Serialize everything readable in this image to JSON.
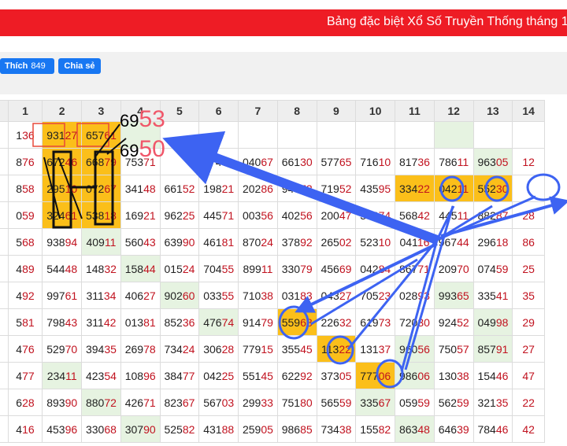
{
  "banner": {
    "title": "Bảng đặc biệt Xổ Số Truyền Thống tháng 11"
  },
  "social": {
    "like_label": "Thích",
    "like_count": "849",
    "share_label": "Chia sẻ"
  },
  "columns": [
    "0",
    "1",
    "2",
    "3",
    "4",
    "5",
    "6",
    "7",
    "8",
    "9",
    "10",
    "11",
    "12",
    "13",
    "14"
  ],
  "rows": [
    [
      "",
      "136",
      "93127",
      "65761",
      "",
      "",
      "",
      "",
      "",
      "",
      "",
      "",
      "",
      "",
      ""
    ],
    [
      "",
      "876",
      "67246",
      "66879",
      "75371",
      "",
      "77471",
      "04067",
      "66130",
      "57765",
      "71610",
      "81736",
      "78611",
      "96305",
      "12"
    ],
    [
      "",
      "858",
      "29510",
      "07267",
      "34148",
      "66152",
      "19821",
      "20286",
      "94772",
      "71952",
      "43595",
      "33422",
      "04211",
      "55230",
      ""
    ],
    [
      "",
      "059",
      "32461",
      "53818",
      "16921",
      "96225",
      "44571",
      "00356",
      "40256",
      "20047",
      "37874",
      "56842",
      "44511",
      "88287",
      "28"
    ],
    [
      "",
      "568",
      "93894",
      "40911",
      "56043",
      "63990",
      "46181",
      "87024",
      "37892",
      "26502",
      "52310",
      "04116",
      "96744",
      "29618",
      "86"
    ],
    [
      "",
      "489",
      "54448",
      "14832",
      "15844",
      "01524",
      "70455",
      "89911",
      "33079",
      "45669",
      "04284",
      "86771",
      "20970",
      "07459",
      "25"
    ],
    [
      "",
      "492",
      "99761",
      "31134",
      "40627",
      "90260",
      "03355",
      "71038",
      "03183",
      "04327",
      "70523",
      "02893",
      "99365",
      "33541",
      "35"
    ],
    [
      "",
      "581",
      "79843",
      "31142",
      "01381",
      "85236",
      "47674",
      "91479",
      "55968",
      "22632",
      "61973",
      "72030",
      "92452",
      "04998",
      "29"
    ],
    [
      "",
      "476",
      "52970",
      "39435",
      "26978",
      "73424",
      "30628",
      "77915",
      "35545",
      "11322",
      "13137",
      "96056",
      "75057",
      "85791",
      "27"
    ],
    [
      "",
      "477",
      "23411",
      "42354",
      "10896",
      "38477",
      "04225",
      "55145",
      "62292",
      "37305",
      "77706",
      "98606",
      "13038",
      "15446",
      "47"
    ],
    [
      "",
      "628",
      "89390",
      "88072",
      "42671",
      "82367",
      "56703",
      "29933",
      "75180",
      "56559",
      "33567",
      "05959",
      "56259",
      "32135",
      "22"
    ],
    [
      "",
      "416",
      "45396",
      "33068",
      "30790",
      "52582",
      "43188",
      "25905",
      "98685",
      "73438",
      "15582",
      "86348",
      "64639",
      "78446",
      "42"
    ]
  ],
  "highlight_cells": [
    [
      0,
      2
    ],
    [
      0,
      3
    ],
    [
      1,
      2
    ],
    [
      1,
      3
    ],
    [
      2,
      2
    ],
    [
      2,
      3
    ],
    [
      3,
      2
    ],
    [
      3,
      3
    ],
    [
      2,
      11
    ],
    [
      2,
      12
    ],
    [
      2,
      13
    ],
    [
      7,
      8
    ],
    [
      8,
      9
    ],
    [
      9,
      10
    ]
  ],
  "green_cells": [
    [
      0,
      4
    ],
    [
      0,
      12
    ],
    [
      1,
      13
    ],
    [
      4,
      3
    ],
    [
      5,
      4
    ],
    [
      6,
      5
    ],
    [
      6,
      12
    ],
    [
      7,
      6
    ],
    [
      7,
      13
    ],
    [
      8,
      11
    ],
    [
      8,
      13
    ],
    [
      9,
      2
    ],
    [
      9,
      11
    ],
    [
      10,
      3
    ],
    [
      10,
      10
    ],
    [
      11,
      4
    ],
    [
      11,
      11
    ]
  ],
  "annotations": {
    "line1_small": "69",
    "line1_big": "53",
    "line2_small": "69",
    "line2_big": "50"
  },
  "colors": {
    "banner": "#ee1c25",
    "highlight": "#fbbf1a",
    "green": "#e6f3e1",
    "arrow": "#3d63f2",
    "tail": "#c1121f"
  }
}
